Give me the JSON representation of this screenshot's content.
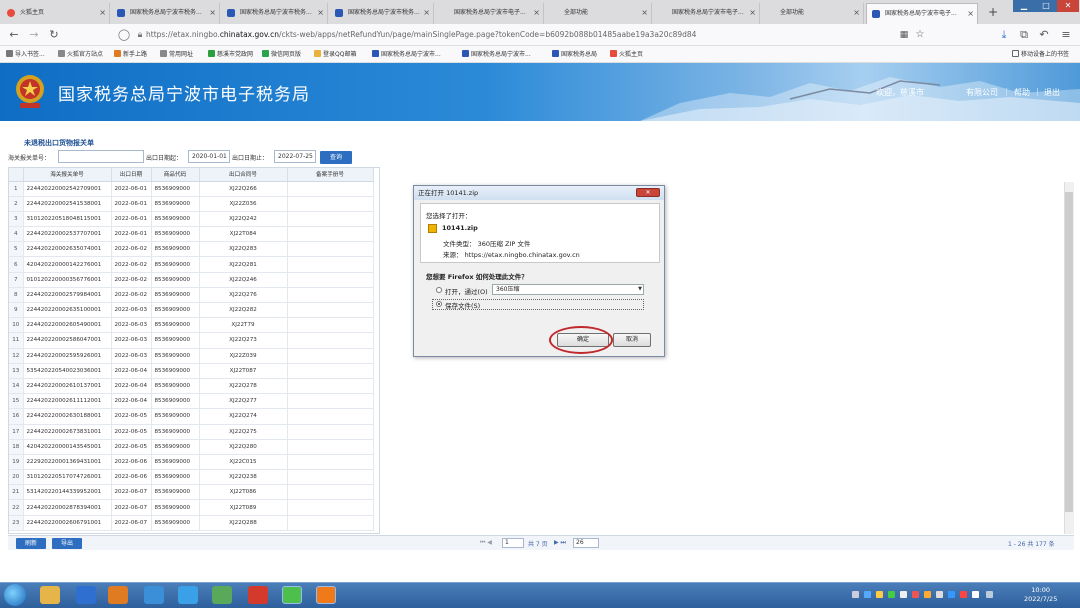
{
  "browser": {
    "tabs": [
      {
        "label": "火狐主页",
        "icon": "firefox-icon",
        "active": false
      },
      {
        "label": "国家税务总局宁波市税务...",
        "icon": "tax-icon",
        "active": false
      },
      {
        "label": "国家税务总局宁波市税务...",
        "icon": "tax-icon",
        "active": false
      },
      {
        "label": "国家税务总局宁波市税务...",
        "icon": "tax-icon",
        "active": false
      },
      {
        "label": "国家税务总局宁波市电子...",
        "icon": "none",
        "active": false
      },
      {
        "label": "全部功能",
        "icon": "none",
        "active": false
      },
      {
        "label": "国家税务总局宁波市电子...",
        "icon": "none",
        "active": false
      },
      {
        "label": "全部功能",
        "icon": "none",
        "active": false
      },
      {
        "label": "国家税务总局宁波市电子...",
        "icon": "tax-icon",
        "active": true
      }
    ],
    "url_prefix": "https://etax.ningbo.",
    "url_domain": "chinatax.gov.cn",
    "url_rest": "/ckts-web/apps/netRefundYun/page/mainSinglePage.page?tokenCode=b6092b088b01485aabe19a3a20c89d84",
    "bookmarks": [
      "导入书签...",
      "火狐官方站点",
      "新手上路",
      "常用网址",
      "慈溪市党政网",
      "微信网页版",
      "登录QQ邮箱",
      "国家税务总局宁波市...",
      "国家税务总局宁波市...",
      "国家税务总局",
      "火狐主页"
    ],
    "mobile_bookmarks": "移动设备上的书签"
  },
  "header": {
    "site_title": "国家税务总局宁波市电子税务局",
    "welcome": "欢迎，慈溪市",
    "company": "有限公司",
    "help": "帮助",
    "exit": "退出"
  },
  "section_title": "未退税出口货物报关单",
  "filters": {
    "customs_label": "海关报关单号：",
    "customs_value": "",
    "date_start_label": "出口日期起：",
    "date_start_value": "2020-01-01",
    "date_end_label": "出口日期止：",
    "date_end_value": "2022-07-25",
    "query_label": "查询"
  },
  "table": {
    "columns": [
      "",
      "海关报关单号",
      "出口日期",
      "商品代码",
      "出口合同号",
      "备案手册号"
    ],
    "rows": [
      [
        "1",
        "224420220002542709001",
        "2022-06-01",
        "8536909000",
        "XJ22Q266",
        ""
      ],
      [
        "2",
        "224420220002541538001",
        "2022-06-01",
        "8536909000",
        "XJ22Z036",
        ""
      ],
      [
        "3",
        "310120220518048115001",
        "2022-06-01",
        "8536909000",
        "XJ22Q242",
        ""
      ],
      [
        "4",
        "224420220002537707001",
        "2022-06-01",
        "8536909000",
        "XJ22T084",
        ""
      ],
      [
        "5",
        "224420220002635074001",
        "2022-06-02",
        "8536909000",
        "XJ22Q283",
        ""
      ],
      [
        "6",
        "420420220000142276001",
        "2022-06-02",
        "8536909000",
        "XJ22Q281",
        ""
      ],
      [
        "7",
        "010120220000356776001",
        "2022-06-02",
        "8536909000",
        "XJ22Q246",
        ""
      ],
      [
        "8",
        "224420220002579984001",
        "2022-06-02",
        "8536909000",
        "XJ22Q276",
        ""
      ],
      [
        "9",
        "224420220002635100001",
        "2022-06-03",
        "8536909000",
        "XJ22Q282",
        ""
      ],
      [
        "10",
        "224420220002605490001",
        "2022-06-03",
        "8536909000",
        "XJ22T79",
        ""
      ],
      [
        "11",
        "224420220002586047001",
        "2022-06-03",
        "8536909000",
        "XJ22Q273",
        ""
      ],
      [
        "12",
        "224420220002595926001",
        "2022-06-03",
        "8536909000",
        "XJ22Z039",
        ""
      ],
      [
        "13",
        "535420220540023036001",
        "2022-06-04",
        "8536909000",
        "XJ22T087",
        ""
      ],
      [
        "14",
        "224420220002610137001",
        "2022-06-04",
        "8536909000",
        "XJ22Q278",
        ""
      ],
      [
        "15",
        "224420220002611112001",
        "2022-06-04",
        "8536909000",
        "XJ22Q277",
        ""
      ],
      [
        "16",
        "224420220002630188001",
        "2022-06-05",
        "8536909000",
        "XJ22Q274",
        ""
      ],
      [
        "17",
        "224420220002673831001",
        "2022-06-05",
        "8536909000",
        "XJ22Q275",
        ""
      ],
      [
        "18",
        "420420220000143545001",
        "2022-06-05",
        "8536909000",
        "XJ22Q280",
        ""
      ],
      [
        "19",
        "222920220001369431001",
        "2022-06-06",
        "8536909000",
        "XJ22C015",
        ""
      ],
      [
        "20",
        "310120220517074726001",
        "2022-06-06",
        "8536909000",
        "XJ22Q238",
        ""
      ],
      [
        "21",
        "531420220144339952001",
        "2022-06-07",
        "8536909000",
        "XJ22T086",
        ""
      ],
      [
        "22",
        "224420220002878394001",
        "2022-06-07",
        "8536909000",
        "XJ22T089",
        ""
      ],
      [
        "23",
        "224420220002606791001",
        "2022-06-07",
        "8536909000",
        "XJ22Q288",
        ""
      ]
    ]
  },
  "bottom": {
    "refresh": "刷新",
    "export": "导出",
    "page_input": "1",
    "page_total": "共 7 页",
    "page_size": "26",
    "range": "1 - 26  共 177 条"
  },
  "dialog": {
    "title": "正在打开 10141.zip",
    "intro": "您选择了打开：",
    "filename": "10141.zip",
    "filetype": "文件类型： 360压缩 ZIP 文件",
    "source": "来源： https://etax.ningbo.chinatax.gov.cn",
    "question": "您想要 Firefox 如何处理此文件？",
    "open_with": "打开，通过(O)",
    "open_app": "360压缩",
    "save_file": "保存文件(S)",
    "ok": "确定",
    "cancel": "取消"
  },
  "taskbar": {
    "time": "10:00",
    "date": "2022/7/25"
  },
  "colors": {
    "header_blue": "#1a73c8",
    "link_blue": "#2d6ec0",
    "highlight_red": "#c0282c"
  }
}
